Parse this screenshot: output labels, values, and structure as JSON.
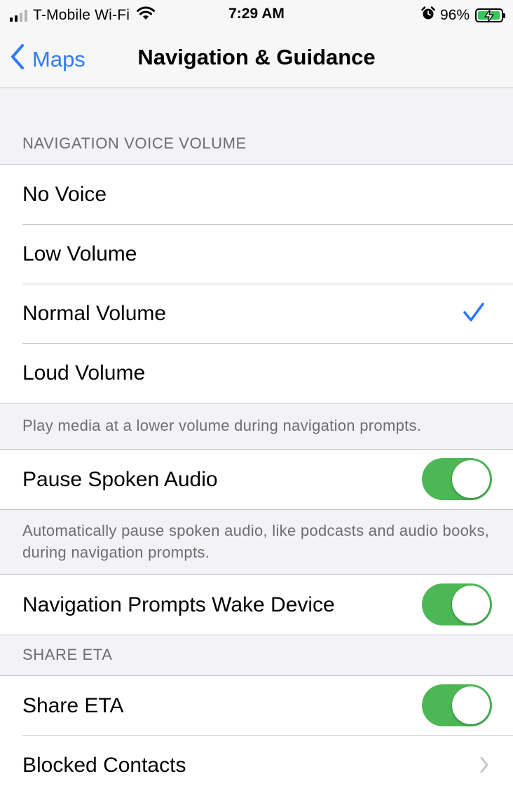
{
  "status_bar": {
    "carrier": "T-Mobile Wi-Fi",
    "time": "7:29 AM",
    "battery_percent": "96%",
    "battery_level": 0.96,
    "signal_bars_filled": 2,
    "icons": [
      "signal-icon",
      "wifi-icon",
      "alarm-icon",
      "battery-charging-icon"
    ]
  },
  "nav": {
    "back_label": "Maps",
    "title": "Navigation & Guidance"
  },
  "voice_volume": {
    "header": "NAVIGATION VOICE VOLUME",
    "options": [
      {
        "label": "No Voice",
        "selected": false
      },
      {
        "label": "Low Volume",
        "selected": false
      },
      {
        "label": "Normal Volume",
        "selected": true
      },
      {
        "label": "Loud Volume",
        "selected": false
      }
    ],
    "footer": "Play media at a lower volume during navigation prompts."
  },
  "pause_audio": {
    "label": "Pause Spoken Audio",
    "enabled": true,
    "footer": "Automatically pause spoken audio, like podcasts and audio books, during navigation prompts."
  },
  "wake_device": {
    "label": "Navigation Prompts Wake Device",
    "enabled": true
  },
  "share_eta": {
    "header": "SHARE ETA",
    "toggle_label": "Share ETA",
    "enabled": true,
    "blocked_contacts_label": "Blocked Contacts"
  },
  "colors": {
    "accent": "#2f7bf5",
    "toggle_on": "#4cb855",
    "background": "#f2f2f7",
    "secondary_text": "#6d6d72"
  }
}
